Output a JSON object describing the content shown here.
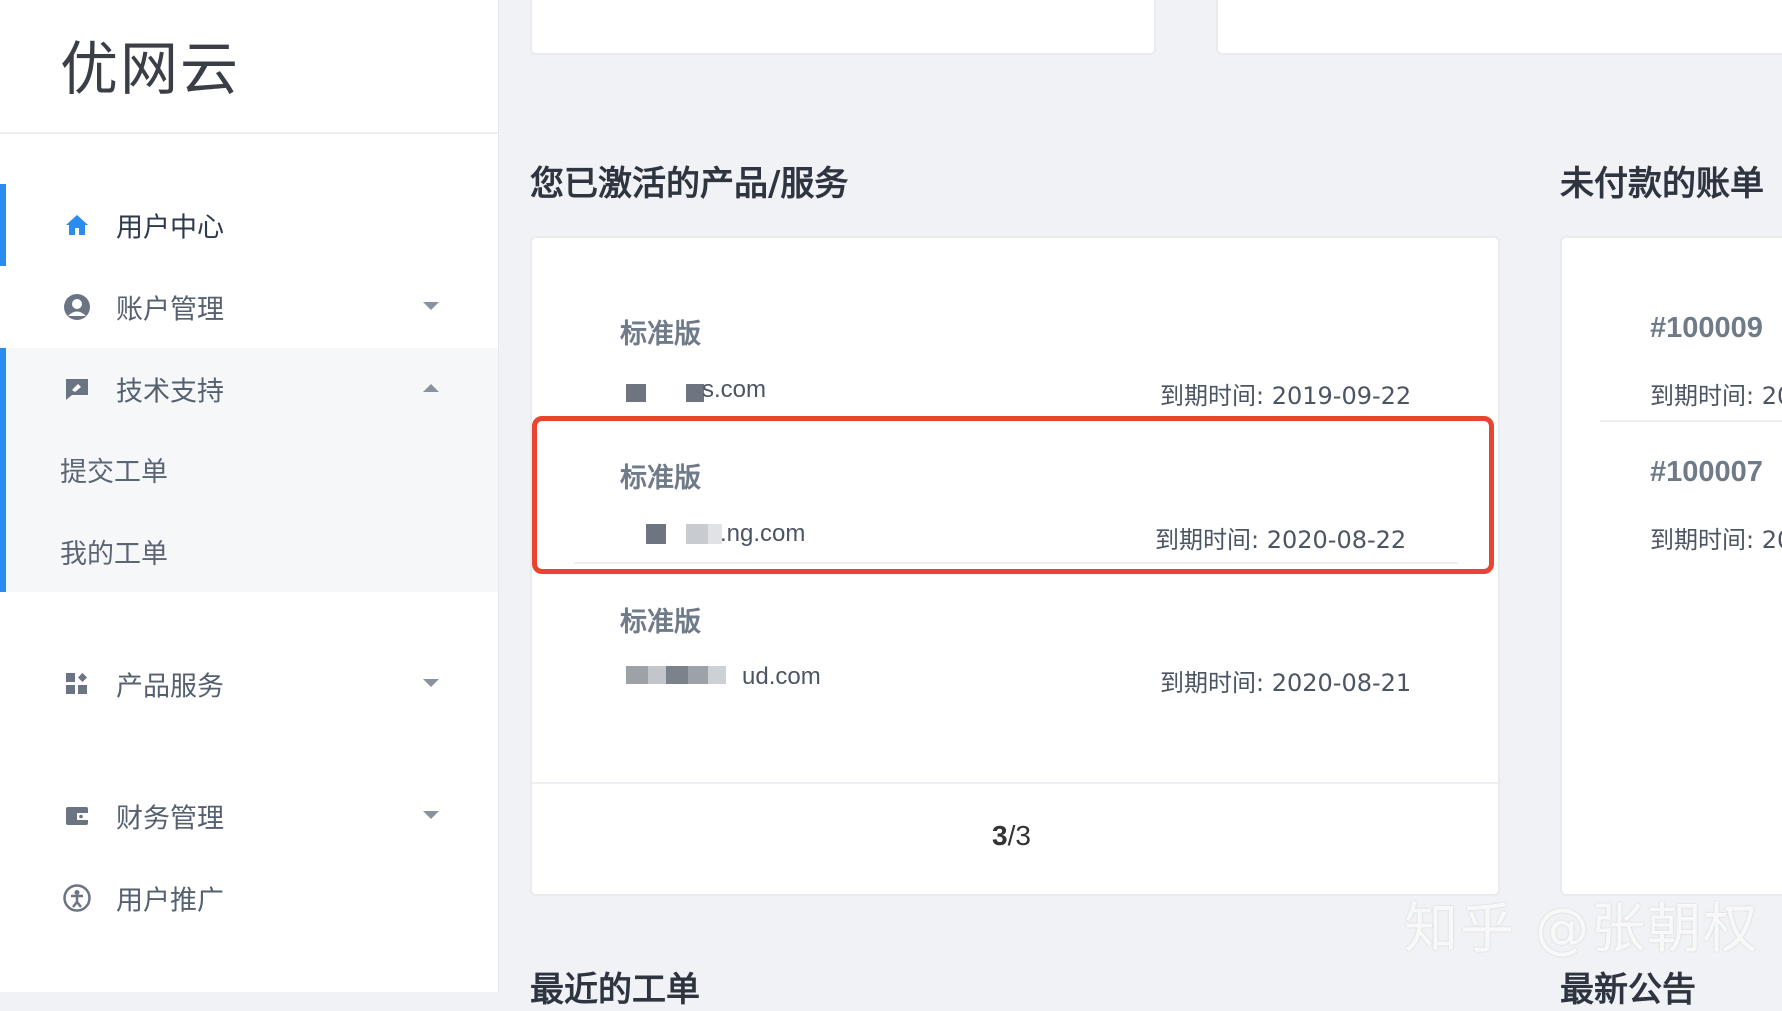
{
  "sidebar": {
    "logo": "优网云",
    "items": [
      {
        "label": "用户中心",
        "icon": "home-icon"
      },
      {
        "label": "账户管理",
        "icon": "user-circle-icon"
      },
      {
        "label": "技术支持",
        "icon": "support-chat-icon"
      },
      {
        "label": "产品服务",
        "icon": "grid-plus-icon"
      },
      {
        "label": "财务管理",
        "icon": "wallet-icon"
      },
      {
        "label": "用户推广",
        "icon": "share-icon"
      }
    ],
    "support_sub_items": [
      {
        "label": "提交工单"
      },
      {
        "label": "我的工单"
      }
    ]
  },
  "main": {
    "products_title": "您已激活的产品/服务",
    "products": [
      {
        "plan": "标准版",
        "domain": "s.com",
        "expiry": "到期时间: 2019-09-22"
      },
      {
        "plan": "标准版",
        "domain": ".ng.com",
        "expiry": "到期时间: 2020-08-22"
      },
      {
        "plan": "标准版",
        "domain": "ud.com",
        "expiry": "到期时间: 2020-08-21"
      }
    ],
    "pager": {
      "current": "3",
      "total": "/3"
    },
    "bills_title": "未付款的账单",
    "bills": [
      {
        "id": "#100009",
        "expiry": "到期时间: 20"
      },
      {
        "id": "#100007",
        "expiry": "到期时间: 20"
      }
    ],
    "tickets_title": "最近的工单",
    "news_title": "最新公告"
  },
  "watermark": "知乎 @张朝权",
  "colors": {
    "accent": "#2a8cf0",
    "highlight": "#e8442f"
  }
}
